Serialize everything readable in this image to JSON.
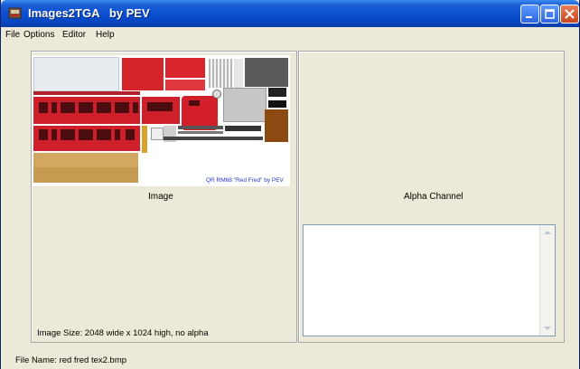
{
  "window": {
    "title": "Images2TGA   by PEV",
    "accent_color": "#0a4fd0"
  },
  "menu": {
    "items": [
      "File",
      "Options",
      "Editor",
      "Help"
    ]
  },
  "left_panel": {
    "caption": "Image",
    "image_watermark": "QR RM68 \"Red Fred\" by PEV",
    "status": "Image Size: 2048 wide x 1024 high, no alpha"
  },
  "right_panel": {
    "caption": "Alpha Channel"
  },
  "footer": {
    "file_name": "File Name:  red fred tex2.bmp"
  },
  "icons": {
    "app": "app-icon",
    "minimize": "minimize-icon",
    "maximize": "maximize-icon",
    "close": "close-icon",
    "scroll_up": "scroll-up-arrow-icon",
    "scroll_down": "scroll-down-arrow-icon"
  }
}
